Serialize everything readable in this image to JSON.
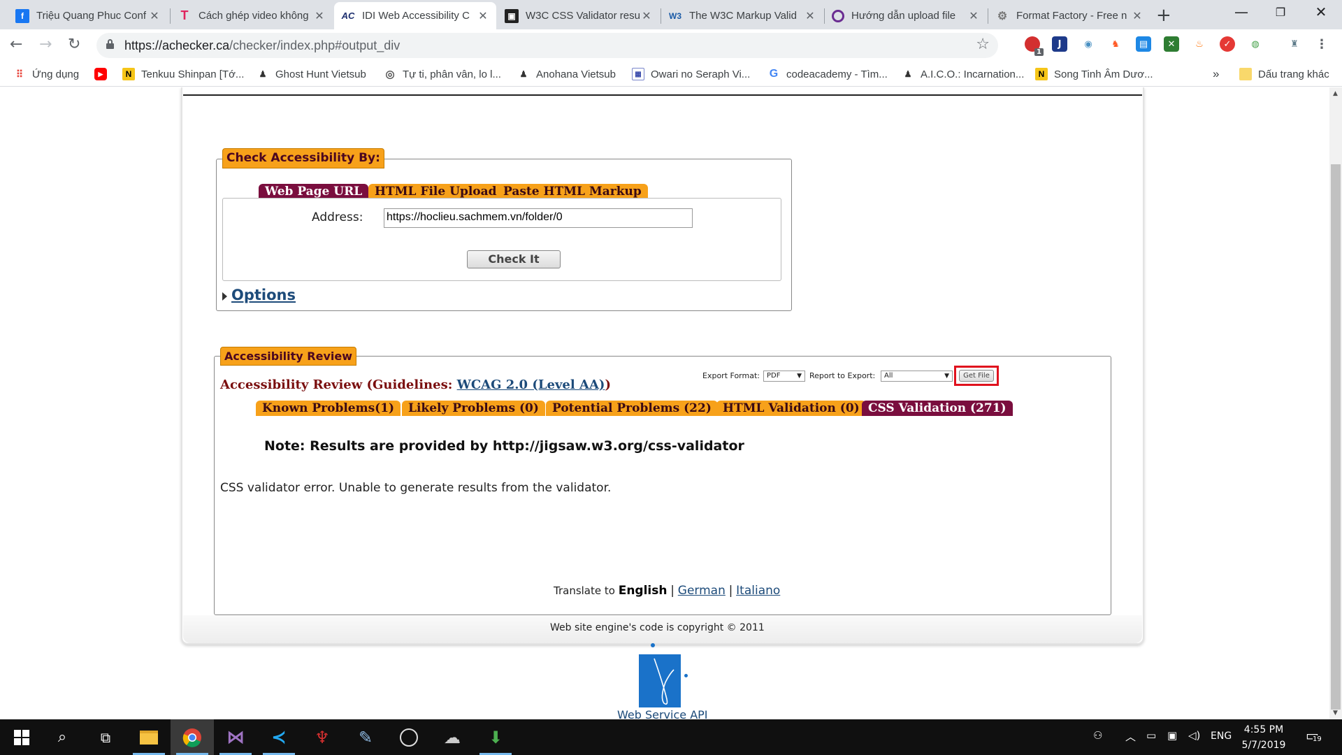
{
  "browser": {
    "tabs": [
      {
        "title": "Triệu Quang Phuc Conf",
        "icon": "facebook-icon",
        "active": false
      },
      {
        "title": "Cách ghép video không",
        "icon": "t-icon",
        "active": false
      },
      {
        "title": "IDI Web Accessibility C",
        "icon": "achecker-icon",
        "active": true
      },
      {
        "title": "W3C CSS Validator resu",
        "icon": "w3c-css-icon",
        "active": false
      },
      {
        "title": "The W3C Markup Valid",
        "icon": "w3c-icon",
        "active": false
      },
      {
        "title": "Hướng dẫn upload file",
        "icon": "q-icon",
        "active": false
      },
      {
        "title": "Format Factory - Free n",
        "icon": "formatfactory-icon",
        "active": false
      }
    ],
    "fav_text": {
      "w3c": "W3",
      "ac": "AC",
      "t": "T"
    },
    "url_host": "https://achecker.ca",
    "url_path": "/checker/index.php#output_div",
    "extension_badge": "1",
    "bookmarks": [
      {
        "label": "Ứng dụng",
        "icon": "apps-grid-icon"
      },
      {
        "label": "",
        "icon": "youtube-icon"
      },
      {
        "label": "Tenkuu Shinpan [Tớ...",
        "icon": "n-icon"
      },
      {
        "label": "Ghost Hunt Vietsub",
        "icon": "anime-icon"
      },
      {
        "label": "Tự ti, phân vân, lo l...",
        "icon": "globe-icon"
      },
      {
        "label": "Anohana Vietsub",
        "icon": "anime-icon"
      },
      {
        "label": "Owari no Seraph Vi...",
        "icon": "page-icon"
      },
      {
        "label": "codeacademy - Tìm...",
        "icon": "google-icon"
      },
      {
        "label": "A.I.C.O.: Incarnation...",
        "icon": "anime-icon"
      },
      {
        "label": "Song Tinh Âm Dươ...",
        "icon": "n-icon"
      }
    ],
    "bookmarks_more": "»",
    "other_bookmarks": "Dấu trang khác"
  },
  "check": {
    "legend": "Check Accessibility By:",
    "tabs": [
      "Web Page URL",
      "HTML File Upload",
      "Paste HTML Markup"
    ],
    "address_label": "Address:",
    "address_value": "https://hoclieu.sachmem.vn/folder/0",
    "check_button": "Check It",
    "options": "Options"
  },
  "review": {
    "legend": "Accessibility Review",
    "heading_prefix": "Accessibility Review (Guidelines: ",
    "guideline_link": "WCAG 2.0 (Level AA)",
    "heading_suffix": ")",
    "export_format_label": "Export Format:",
    "export_format_value": "PDF",
    "report_label": "Report to Export:",
    "report_value": "All",
    "get_file_button": "Get File",
    "tabs": [
      {
        "label": "Known Problems(1)",
        "selected": false
      },
      {
        "label": "Likely Problems (0)",
        "selected": false
      },
      {
        "label": "Potential Problems (22)",
        "selected": false
      },
      {
        "label": "HTML Validation (0)",
        "selected": false
      },
      {
        "label": "CSS Validation (271)",
        "selected": true
      }
    ],
    "note": "Note: Results are provided by http://jigsaw.w3.org/css-validator",
    "message": "CSS validator error. Unable to generate results from the validator."
  },
  "footer": {
    "translate_prefix": "Translate to",
    "current_language": "English",
    "languages": [
      "German",
      "Italiano"
    ],
    "separator": "|",
    "copyright": "Web site engine's code is copyright © 2011",
    "api_label": "Web Service API"
  },
  "taskbar": {
    "language": "ENG",
    "time": "4:55 PM",
    "date": "5/7/2019",
    "notification_count": "19"
  },
  "colors": {
    "legend_orange": "#f7a11a",
    "tab_selected": "#7a0e3e",
    "link_blue": "#1d4b7a",
    "highlight_red": "#e0121e"
  }
}
